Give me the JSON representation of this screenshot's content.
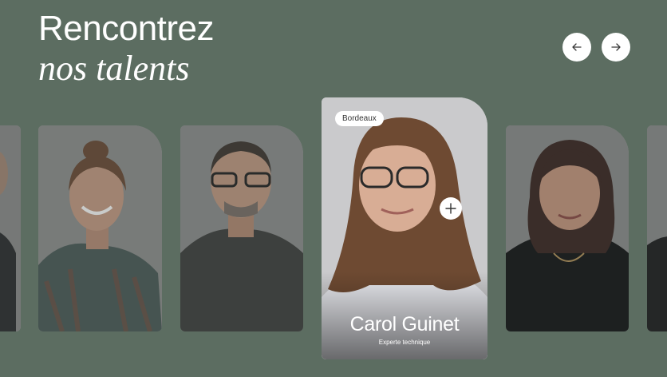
{
  "heading": {
    "line1": "Rencontrez",
    "line2": "nos talents"
  },
  "navigation": {
    "prev_icon": "arrow-left-icon",
    "next_icon": "arrow-right-icon"
  },
  "carousel": {
    "active_card": {
      "city": "Bordeaux",
      "name": "Carol Guinet",
      "role": "Experte technique",
      "action_icon": "plus-icon"
    }
  },
  "colors": {
    "background": "#5c6d61",
    "card_background": "#c9c9cb",
    "button": "#ffffff",
    "text": "#ffffff"
  }
}
